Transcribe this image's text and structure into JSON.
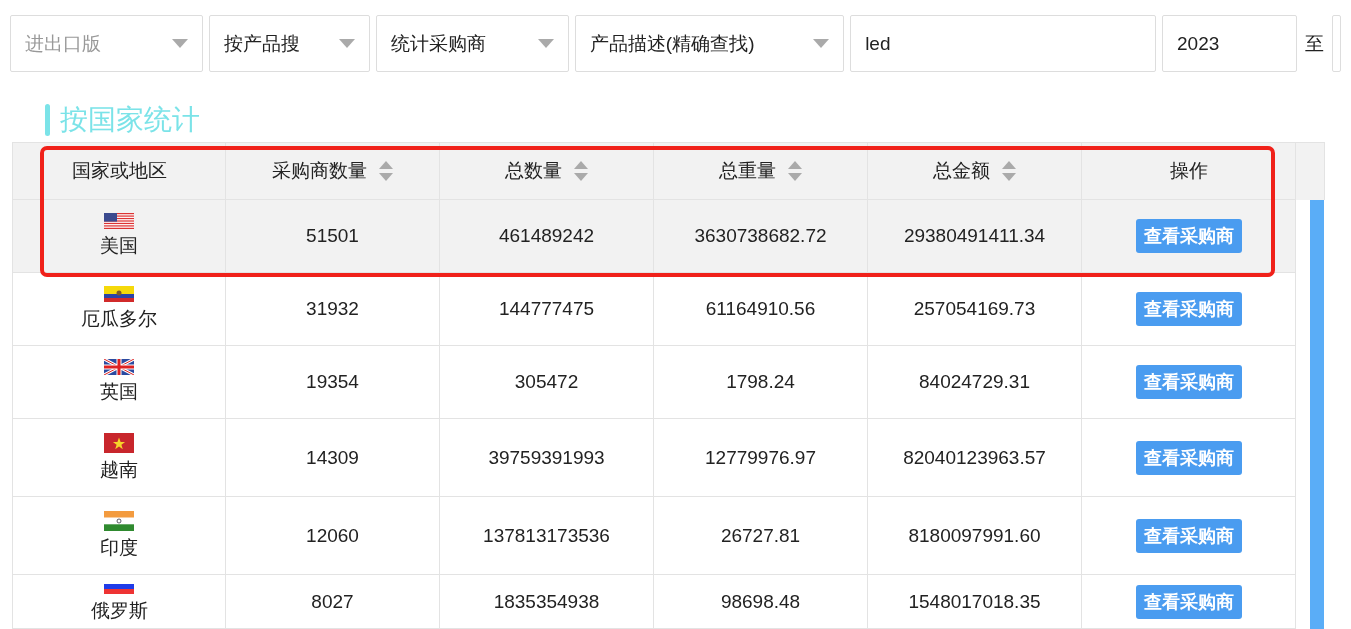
{
  "filters": [
    {
      "kind": "select",
      "placeholder": "进出口版"
    },
    {
      "kind": "select",
      "value": "按产品搜"
    },
    {
      "kind": "select",
      "value": "统计采购商"
    },
    {
      "kind": "select",
      "value": "产品描述(精确查找)"
    },
    {
      "kind": "input",
      "value": "led"
    },
    {
      "kind": "input",
      "value": "2023"
    },
    {
      "kind": "text",
      "value": "至"
    },
    {
      "kind": "input"
    }
  ],
  "section_title": "按国家统计",
  "table": {
    "columns": [
      {
        "label": "国家或地区",
        "sortable": false
      },
      {
        "label": "采购商数量",
        "sortable": true
      },
      {
        "label": "总数量",
        "sortable": true
      },
      {
        "label": "总重量",
        "sortable": true
      },
      {
        "label": "总金额",
        "sortable": true
      },
      {
        "label": "操作",
        "sortable": false
      }
    ],
    "rows": [
      {
        "country": "美国",
        "buyers": "51501",
        "quantity": "461489242",
        "weight": "3630738682.72",
        "amount": "29380491411.34",
        "action": "查看采购商",
        "selected": true,
        "highlighted": true
      },
      {
        "country": "厄瓜多尔",
        "buyers": "31932",
        "quantity": "144777475",
        "weight": "61164910.56",
        "amount": "257054169.73",
        "action": "查看采购商",
        "selected": false,
        "highlighted": false
      },
      {
        "country": "英国",
        "buyers": "19354",
        "quantity": "305472",
        "weight": "1798.24",
        "amount": "84024729.31",
        "action": "查看采购商",
        "selected": false,
        "highlighted": false
      },
      {
        "country": "越南",
        "buyers": "14309",
        "quantity": "39759391993",
        "weight": "12779976.97",
        "amount": "82040123963.57",
        "action": "查看采购商",
        "selected": false,
        "highlighted": false
      },
      {
        "country": "印度",
        "buyers": "12060",
        "quantity": "137813173536",
        "weight": "26727.81",
        "amount": "8180097991.60",
        "action": "查看采购商",
        "selected": false,
        "highlighted": false
      },
      {
        "country": "俄罗斯",
        "buyers": "8027",
        "quantity": "1835354938",
        "weight": "98698.48",
        "amount": "1548017018.35",
        "action": "查看采购商",
        "selected": false,
        "highlighted": false
      }
    ]
  }
}
